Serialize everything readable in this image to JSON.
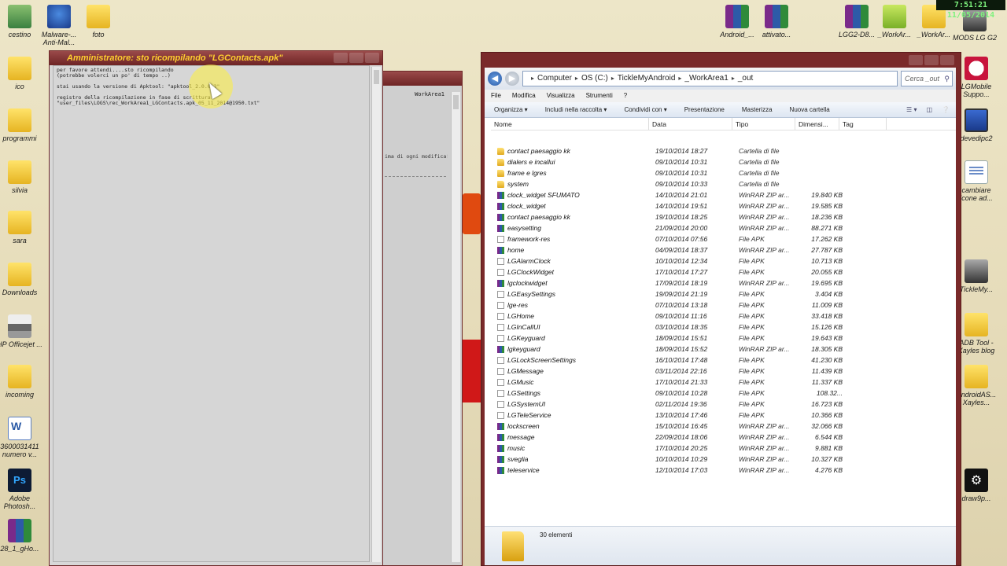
{
  "clock": "7:51:21  11/05/2014",
  "desktop_icons": [
    {
      "label": "cestino",
      "icon": "trash-icon"
    },
    {
      "label": "Malware-... Anti-Mal...",
      "icon": "malware-icon"
    },
    {
      "label": "foto",
      "icon": "folder-icon"
    },
    {
      "label": "ico",
      "icon": "folder-icon"
    },
    {
      "label": "programmi",
      "icon": "folder-icon"
    },
    {
      "label": "silvia",
      "icon": "folder-icon"
    },
    {
      "label": "sara",
      "icon": "folder-icon"
    },
    {
      "label": "Downloads",
      "icon": "folder-icon"
    },
    {
      "label": "HP Officejet ...",
      "icon": "printer-icon"
    },
    {
      "label": "incoming",
      "icon": "folder-icon"
    },
    {
      "label": "3600031411 numero v...",
      "icon": "word-icon"
    },
    {
      "label": "Adobe Photosh...",
      "icon": "photoshop-icon"
    },
    {
      "label": "28_1_gHo...",
      "icon": "rar-icon"
    },
    {
      "label": "Android_...",
      "icon": "rar-icon"
    },
    {
      "label": "attivato...",
      "icon": "rar-icon"
    },
    {
      "label": "LGG2-D8...",
      "icon": "rar-icon"
    },
    {
      "label": "_WorkAr...",
      "icon": "green-folder-icon"
    },
    {
      "label": "_WorkAr...",
      "icon": "folder-icon"
    },
    {
      "label": "MODS LG G2",
      "icon": "phone-icon"
    },
    {
      "label": "LGMobile Suppo...",
      "icon": "lg-icon"
    },
    {
      "label": "devedipc2",
      "icon": "monitor-icon"
    },
    {
      "label": "cambiare icone ad...",
      "icon": "doc-icon"
    },
    {
      "label": "TickleMy...",
      "icon": "phone-icon"
    },
    {
      "label": "ADB Tool - Xayles blog",
      "icon": "folder-icon"
    },
    {
      "label": "AndroidAS... Xayles...",
      "icon": "folder-icon"
    },
    {
      "label": "draw9p...",
      "icon": "gear-icon"
    }
  ],
  "cmd_window": {
    "title": "Amministratore:  sto ricompilando \"LGContacts.apk\"",
    "lines": [
      "per favore attendi....sto ricompilando",
      "(potrebbe volerci un po' di tempo ..)",
      "",
      "stai usando la versione di Apktool: \"apktool_2.0.0b2\"",
      "",
      "registro della ricompilazione in fase di scrittura:",
      "\"user_files\\LOGS\\rec_WorkArea1_LGContacts.apk_05_11_2014@1950.txt\""
    ]
  },
  "back_window": {
    "label": "WorkArea1",
    "snippet": "ima di ogni modifica!"
  },
  "explorer": {
    "breadcrumb": [
      "Computer",
      "OS (C:)",
      "TickleMyAndroid",
      "_WorkArea1",
      "_out"
    ],
    "search_placeholder": "Cerca _out",
    "menu": [
      "File",
      "Modifica",
      "Visualizza",
      "Strumenti",
      "?"
    ],
    "toolbar": [
      "Organizza ▾",
      "Includi nella raccolta ▾",
      "Condividi con ▾",
      "Presentazione",
      "Masterizza",
      "Nuova cartella"
    ],
    "columns": [
      "Nome",
      "Data",
      "Tipo",
      "Dimensi...",
      "Tag"
    ],
    "status": "30 elementi",
    "rows": [
      {
        "name": "contact paesaggio kk",
        "date": "19/10/2014 18:27",
        "type": "Cartella di file",
        "size": "",
        "kind": "folder"
      },
      {
        "name": "dialers e incallui",
        "date": "09/10/2014 10:31",
        "type": "Cartella di file",
        "size": "",
        "kind": "folder"
      },
      {
        "name": "frame e lgres",
        "date": "09/10/2014 10:31",
        "type": "Cartella di file",
        "size": "",
        "kind": "folder"
      },
      {
        "name": "system",
        "date": "09/10/2014 10:33",
        "type": "Cartella di file",
        "size": "",
        "kind": "folder"
      },
      {
        "name": "clock_widget SFUMATO",
        "date": "14/10/2014 21:01",
        "type": "WinRAR ZIP ar...",
        "size": "19.840 KB",
        "kind": "rar"
      },
      {
        "name": "clock_widget",
        "date": "14/10/2014 19:51",
        "type": "WinRAR ZIP ar...",
        "size": "19.585 KB",
        "kind": "rar"
      },
      {
        "name": "contact paesaggio kk",
        "date": "19/10/2014 18:25",
        "type": "WinRAR ZIP ar...",
        "size": "18.236 KB",
        "kind": "rar"
      },
      {
        "name": "easysetting",
        "date": "21/09/2014 20:00",
        "type": "WinRAR ZIP ar...",
        "size": "88.271 KB",
        "kind": "rar"
      },
      {
        "name": "framework-res",
        "date": "07/10/2014 07:56",
        "type": "File APK",
        "size": "17.262 KB",
        "kind": "apk"
      },
      {
        "name": "home",
        "date": "04/09/2014 18:37",
        "type": "WinRAR ZIP ar...",
        "size": "27.787 KB",
        "kind": "rar"
      },
      {
        "name": "LGAlarmClock",
        "date": "10/10/2014 12:34",
        "type": "File APK",
        "size": "10.713 KB",
        "kind": "apk"
      },
      {
        "name": "LGClockWidget",
        "date": "17/10/2014 17:27",
        "type": "File APK",
        "size": "20.055 KB",
        "kind": "apk"
      },
      {
        "name": "lgclockwidget",
        "date": "17/09/2014 18:19",
        "type": "WinRAR ZIP ar...",
        "size": "19.695 KB",
        "kind": "rar"
      },
      {
        "name": "LGEasySettings",
        "date": "19/09/2014 21:19",
        "type": "File APK",
        "size": "3.404 KB",
        "kind": "apk"
      },
      {
        "name": "lge-res",
        "date": "07/10/2014 13:18",
        "type": "File APK",
        "size": "11.009 KB",
        "kind": "apk"
      },
      {
        "name": "LGHome",
        "date": "09/10/2014 11:16",
        "type": "File APK",
        "size": "33.418 KB",
        "kind": "apk"
      },
      {
        "name": "LGInCallUI",
        "date": "03/10/2014 18:35",
        "type": "File APK",
        "size": "15.126 KB",
        "kind": "apk"
      },
      {
        "name": "LGKeyguard",
        "date": "18/09/2014 15:51",
        "type": "File APK",
        "size": "19.643 KB",
        "kind": "apk"
      },
      {
        "name": "lgkeyguard",
        "date": "18/09/2014 15:52",
        "type": "WinRAR ZIP ar...",
        "size": "18.305 KB",
        "kind": "rar"
      },
      {
        "name": "LGLockScreenSettings",
        "date": "16/10/2014 17:48",
        "type": "File APK",
        "size": "41.230 KB",
        "kind": "apk"
      },
      {
        "name": "LGMessage",
        "date": "03/11/2014 22:16",
        "type": "File APK",
        "size": "11.439 KB",
        "kind": "apk"
      },
      {
        "name": "LGMusic",
        "date": "17/10/2014 21:33",
        "type": "File APK",
        "size": "11.337 KB",
        "kind": "apk"
      },
      {
        "name": "LGSettings",
        "date": "09/10/2014 10:28",
        "type": "File APK",
        "size": "108.32...",
        "kind": "apk"
      },
      {
        "name": "LGSystemUI",
        "date": "02/11/2014 19:36",
        "type": "File APK",
        "size": "16.723 KB",
        "kind": "apk"
      },
      {
        "name": "LGTeleService",
        "date": "13/10/2014 17:46",
        "type": "File APK",
        "size": "10.366 KB",
        "kind": "apk"
      },
      {
        "name": "lockscreen",
        "date": "15/10/2014 16:45",
        "type": "WinRAR ZIP ar...",
        "size": "32.066 KB",
        "kind": "rar"
      },
      {
        "name": "message",
        "date": "22/09/2014 18:06",
        "type": "WinRAR ZIP ar...",
        "size": "6.544 KB",
        "kind": "rar"
      },
      {
        "name": "music",
        "date": "17/10/2014 20:25",
        "type": "WinRAR ZIP ar...",
        "size": "9.881 KB",
        "kind": "rar"
      },
      {
        "name": "sveglia",
        "date": "10/10/2014 10:29",
        "type": "WinRAR ZIP ar...",
        "size": "10.327 KB",
        "kind": "rar"
      },
      {
        "name": "teleservice",
        "date": "12/10/2014 17:03",
        "type": "WinRAR ZIP ar...",
        "size": "4.276 KB",
        "kind": "rar"
      }
    ]
  }
}
